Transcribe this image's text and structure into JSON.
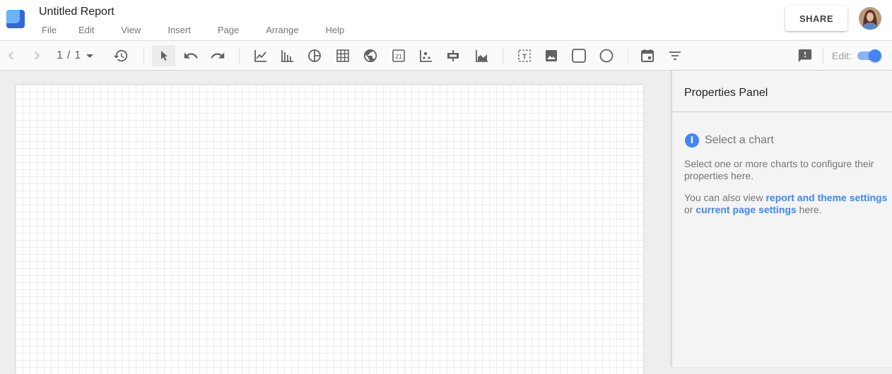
{
  "app": {
    "title": "Untitled Report",
    "brand_colors": {
      "logo_light": "#6ab4f5",
      "logo_dark": "#3367d6",
      "accent": "#4285f4"
    }
  },
  "menu": {
    "items": [
      {
        "label": "File"
      },
      {
        "label": "Edit"
      },
      {
        "label": "View"
      },
      {
        "label": "Insert"
      },
      {
        "label": "Page"
      },
      {
        "label": "Arrange"
      },
      {
        "label": "Help"
      }
    ]
  },
  "header": {
    "share_label": "SHARE",
    "avatar_icon": "user-avatar"
  },
  "toolbar": {
    "pager": {
      "current": "1",
      "separator": "/",
      "total": "1"
    },
    "tools": [
      {
        "name": "prev-page",
        "icon": "chevron-left-icon"
      },
      {
        "name": "next-page",
        "icon": "chevron-right-icon"
      },
      {
        "name": "page-dropdown",
        "icon": "caret-down-icon"
      },
      {
        "name": "version-history",
        "icon": "history-icon"
      },
      {
        "name": "select",
        "icon": "cursor-icon",
        "active": true
      },
      {
        "name": "undo",
        "icon": "undo-icon"
      },
      {
        "name": "redo",
        "icon": "redo-icon"
      },
      {
        "name": "time-series",
        "icon": "line-chart-icon"
      },
      {
        "name": "bar-chart",
        "icon": "bar-chart-icon"
      },
      {
        "name": "pie-chart",
        "icon": "pie-chart-icon"
      },
      {
        "name": "table",
        "icon": "table-icon"
      },
      {
        "name": "geo-map",
        "icon": "globe-icon"
      },
      {
        "name": "scorecard",
        "icon": "scorecard-icon",
        "text": "21"
      },
      {
        "name": "scatter-chart",
        "icon": "scatter-chart-icon"
      },
      {
        "name": "bullet-chart",
        "icon": "bullet-chart-icon"
      },
      {
        "name": "area-chart",
        "icon": "area-chart-icon"
      },
      {
        "name": "text",
        "icon": "text-box-icon",
        "text": "T"
      },
      {
        "name": "image",
        "icon": "image-icon"
      },
      {
        "name": "rectangle",
        "icon": "rectangle-icon"
      },
      {
        "name": "circle",
        "icon": "circle-icon"
      },
      {
        "name": "date-range",
        "icon": "calendar-icon"
      },
      {
        "name": "filter-control",
        "icon": "filter-icon"
      },
      {
        "name": "feedback",
        "icon": "feedback-icon"
      }
    ],
    "edit_label": "Edit:",
    "edit_mode": true
  },
  "canvas": {
    "grid": true
  },
  "properties_panel": {
    "title": "Properties Panel",
    "info_title": "Select a chart",
    "info_icon_text": "i",
    "paragraph1": "Select one or more charts to configure their properties here.",
    "paragraph2_prefix": "You can also view ",
    "link1": "report and theme settings",
    "paragraph2_mid": " or ",
    "link2": "current page settings",
    "paragraph2_suffix": " here."
  }
}
